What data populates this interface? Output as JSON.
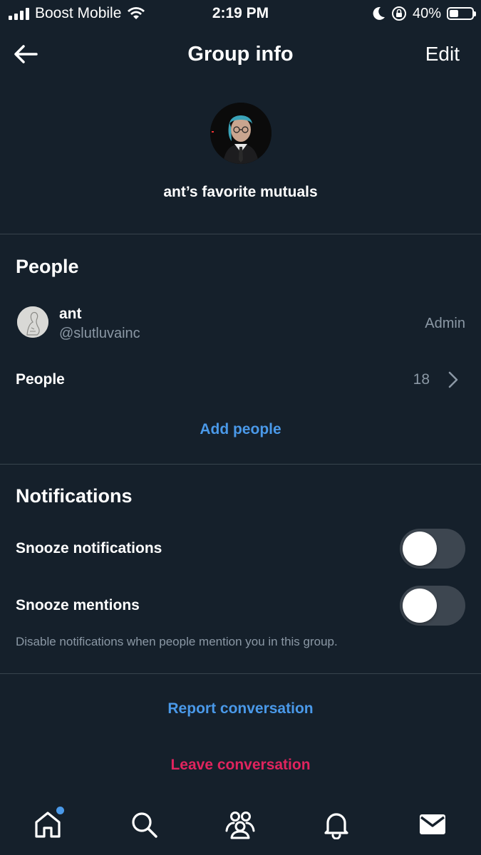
{
  "status_bar": {
    "carrier": "Boost Mobile",
    "time": "2:19 PM",
    "battery_percent": "40%",
    "battery_level": 0.4,
    "icons": [
      "signal-icon",
      "wifi-icon",
      "moon-icon",
      "rotation-lock-icon",
      "battery-icon"
    ]
  },
  "header": {
    "back_icon": "arrow-left-icon",
    "title": "Group info",
    "edit_label": "Edit"
  },
  "group": {
    "name": "ant’s favorite mutuals",
    "avatar": "group-avatar"
  },
  "people_section": {
    "title": "People",
    "members": [
      {
        "name": "ant",
        "handle": "@slutluvainc",
        "role": "Admin",
        "avatar": "member-avatar"
      }
    ],
    "people_row": {
      "label": "People",
      "count": "18",
      "icon": "chevron-right-icon"
    },
    "add_people_label": "Add people"
  },
  "notifications_section": {
    "title": "Notifications",
    "toggles": [
      {
        "label": "Snooze notifications",
        "on": false
      },
      {
        "label": "Snooze mentions",
        "on": false
      }
    ],
    "hint": "Disable notifications when people mention you in this group."
  },
  "actions": {
    "report_label": "Report conversation",
    "leave_label": "Leave conversation"
  },
  "tab_bar": {
    "tabs": [
      {
        "name": "home",
        "icon": "home-icon",
        "has_badge": true
      },
      {
        "name": "search",
        "icon": "search-icon",
        "has_badge": false
      },
      {
        "name": "communities",
        "icon": "communities-icon",
        "has_badge": false
      },
      {
        "name": "notifications",
        "icon": "bell-icon",
        "has_badge": false
      },
      {
        "name": "messages",
        "icon": "mail-icon",
        "has_badge": false
      }
    ]
  },
  "colors": {
    "background": "#15202b",
    "divider": "#38444d",
    "link_blue": "#4a99e9",
    "danger_red": "#e0245e",
    "secondary_text": "#8b98a5",
    "toggle_off": "#3d4650"
  }
}
